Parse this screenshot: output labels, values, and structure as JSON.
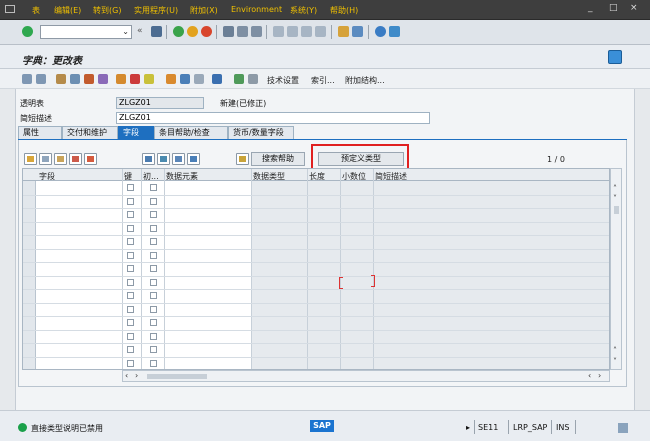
{
  "menu": [
    "表",
    "编辑(E)",
    "转到(G)",
    "实用程序(U)",
    "附加(X)",
    "Environment",
    "系统(Y)",
    "帮助(H)"
  ],
  "window_controls": [
    "_",
    "□",
    "×"
  ],
  "title": "字典：更改表",
  "app_toolbar": {
    "tech_settings": "技术设置",
    "indexes": "索引...",
    "append_struct": "附加结构..."
  },
  "header": {
    "table_label": "透明表",
    "table_value": "ZLGZ01",
    "status": "新建(已修正)",
    "desc_label": "简短描述",
    "desc_value": "ZLGZ01"
  },
  "tabs": [
    "属性",
    "交付和维护",
    "字段",
    "条目帮助/检查",
    "货币/数量字段"
  ],
  "active_tab": 2,
  "buttons": {
    "search_help": "搜索帮助",
    "predefined_type": "预定义类型"
  },
  "counter": "1 / 0",
  "columns": [
    "字段",
    "键",
    "初...",
    "数据元素",
    "数据类型",
    "长度",
    "小数位",
    "简短描述"
  ],
  "status_bar": {
    "message": "直接类型说明已禁用",
    "logo": "SAP",
    "tcode": "SE11",
    "system": "LRP_SAP",
    "mode": "INS"
  },
  "colors": {
    "accent": "#1e6fc0",
    "highlight": "#e02020",
    "menu_text": "#f0c000"
  }
}
